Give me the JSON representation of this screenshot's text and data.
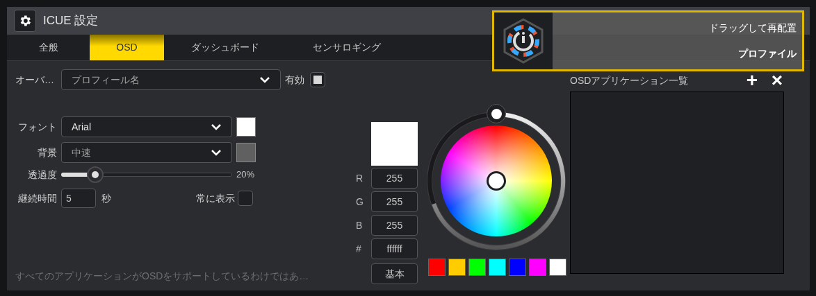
{
  "window": {
    "title": "ICUE 設定"
  },
  "tabs": [
    {
      "label": "全般",
      "selected": false
    },
    {
      "label": "OSD",
      "selected": true
    },
    {
      "label": "ダッシュボード",
      "selected": false
    },
    {
      "label": "センサロギング",
      "selected": false
    }
  ],
  "overlay_row": {
    "label": "オーバ…",
    "dropdown": "プロフィール名",
    "enabled_label": "有効",
    "enabled_checked": true
  },
  "font_row": {
    "label": "フォント",
    "dropdown": "Arial",
    "color": "#ffffff"
  },
  "background_row": {
    "label": "背景",
    "dropdown": "中速",
    "color": "#606060"
  },
  "opacity": {
    "label": "透過度",
    "level": 0.2,
    "reading": "20%"
  },
  "duration": {
    "label": "継続時間",
    "value": "5",
    "unit": "秒",
    "always_show_label": "常に表示",
    "always_show_checked": false
  },
  "footer_note": "すべてのアプリケーションがOSDをサポートしているわけではあ…",
  "color_picker": {
    "fields": [
      {
        "label": "R",
        "value": "255"
      },
      {
        "label": "G",
        "value": "255"
      },
      {
        "label": "B",
        "value": "255"
      },
      {
        "label": "#",
        "value": "ffffff"
      }
    ],
    "basic_button": "基本",
    "swatches": [
      {
        "color": "#ff0000"
      },
      {
        "color": "#ffcc00"
      },
      {
        "color": "#00ff00"
      },
      {
        "color": "#00ffff"
      },
      {
        "color": "#0000ff"
      },
      {
        "color": "#ff00ff"
      },
      {
        "color": "#ffffff"
      }
    ]
  },
  "app_list": {
    "title": "OSDアプリケーション一覧",
    "add_button": "+",
    "remove_button": "×"
  },
  "osd_overlay": {
    "line_1": "ドラッグして再配置",
    "line_2": "プロファイル"
  }
}
